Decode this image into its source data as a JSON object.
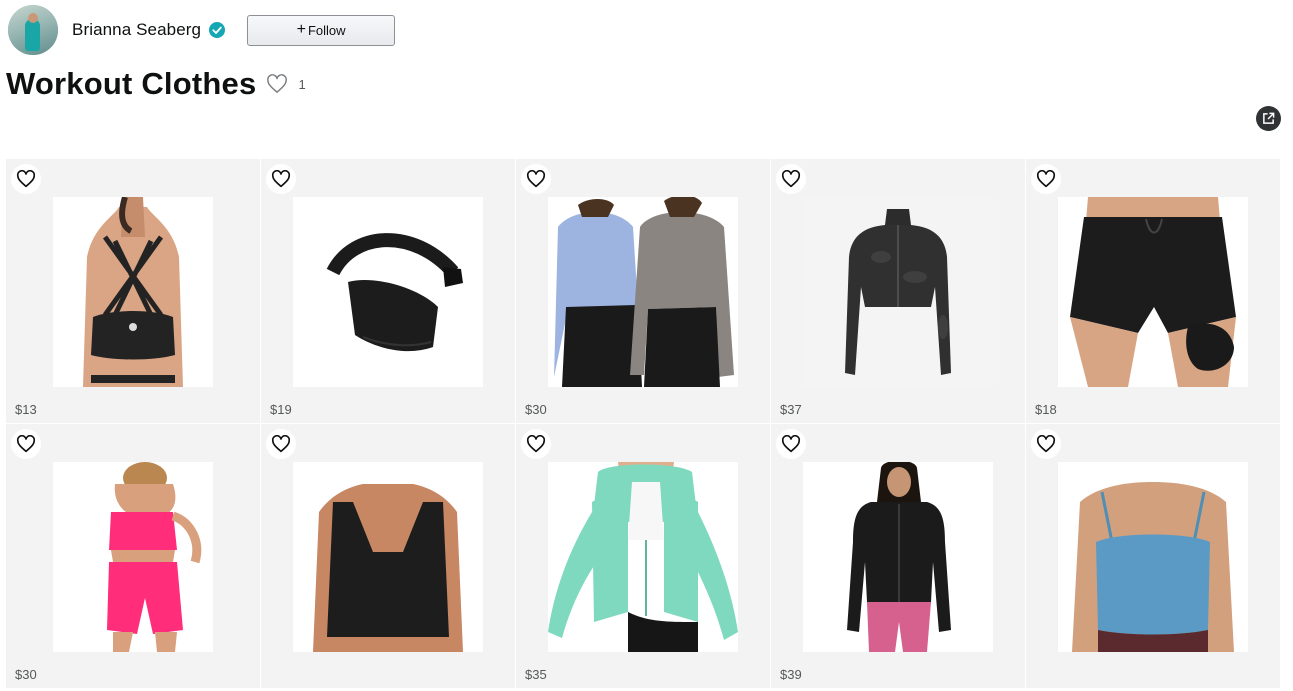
{
  "creator": {
    "name": "Brianna Seaberg",
    "verified": true,
    "avatar_icon": "profile-photo",
    "follow_label": "Follow",
    "follow_icon": "plus-icon"
  },
  "list": {
    "title": "Workout Clothes",
    "like_count": "1",
    "heart_icon": "heart-outline-icon",
    "share_icon": "share-icon"
  },
  "products": [
    {
      "price": "$13",
      "image": "black strappy sports bra",
      "heart_icon": "heart-outline-icon"
    },
    {
      "price": "$19",
      "image": "black belt bag",
      "heart_icon": "heart-outline-icon"
    },
    {
      "price": "$30",
      "image": "blue and grey long sleeve crop tops",
      "heart_icon": "heart-outline-icon"
    },
    {
      "price": "$37",
      "image": "black camo zip cropped jacket",
      "heart_icon": "heart-outline-icon"
    },
    {
      "price": "$18",
      "image": "black running shorts",
      "heart_icon": "heart-outline-icon"
    },
    {
      "price": "$30",
      "image": "pink crop top and shorts set",
      "heart_icon": "heart-outline-icon"
    },
    {
      "price": "",
      "image": "black longline tank top",
      "heart_icon": "heart-outline-icon"
    },
    {
      "price": "$35",
      "image": "mint green zip hoodie",
      "heart_icon": "heart-outline-icon"
    },
    {
      "price": "$39",
      "image": "black zip running jacket",
      "heart_icon": "heart-outline-icon"
    },
    {
      "price": "",
      "image": "blue cropped cami tank",
      "heart_icon": "heart-outline-icon"
    }
  ],
  "colors": {
    "verified_badge": "#16a7b4",
    "text": "#0f1111",
    "muted": "#565959",
    "card_bg": "#f3f3f3"
  }
}
